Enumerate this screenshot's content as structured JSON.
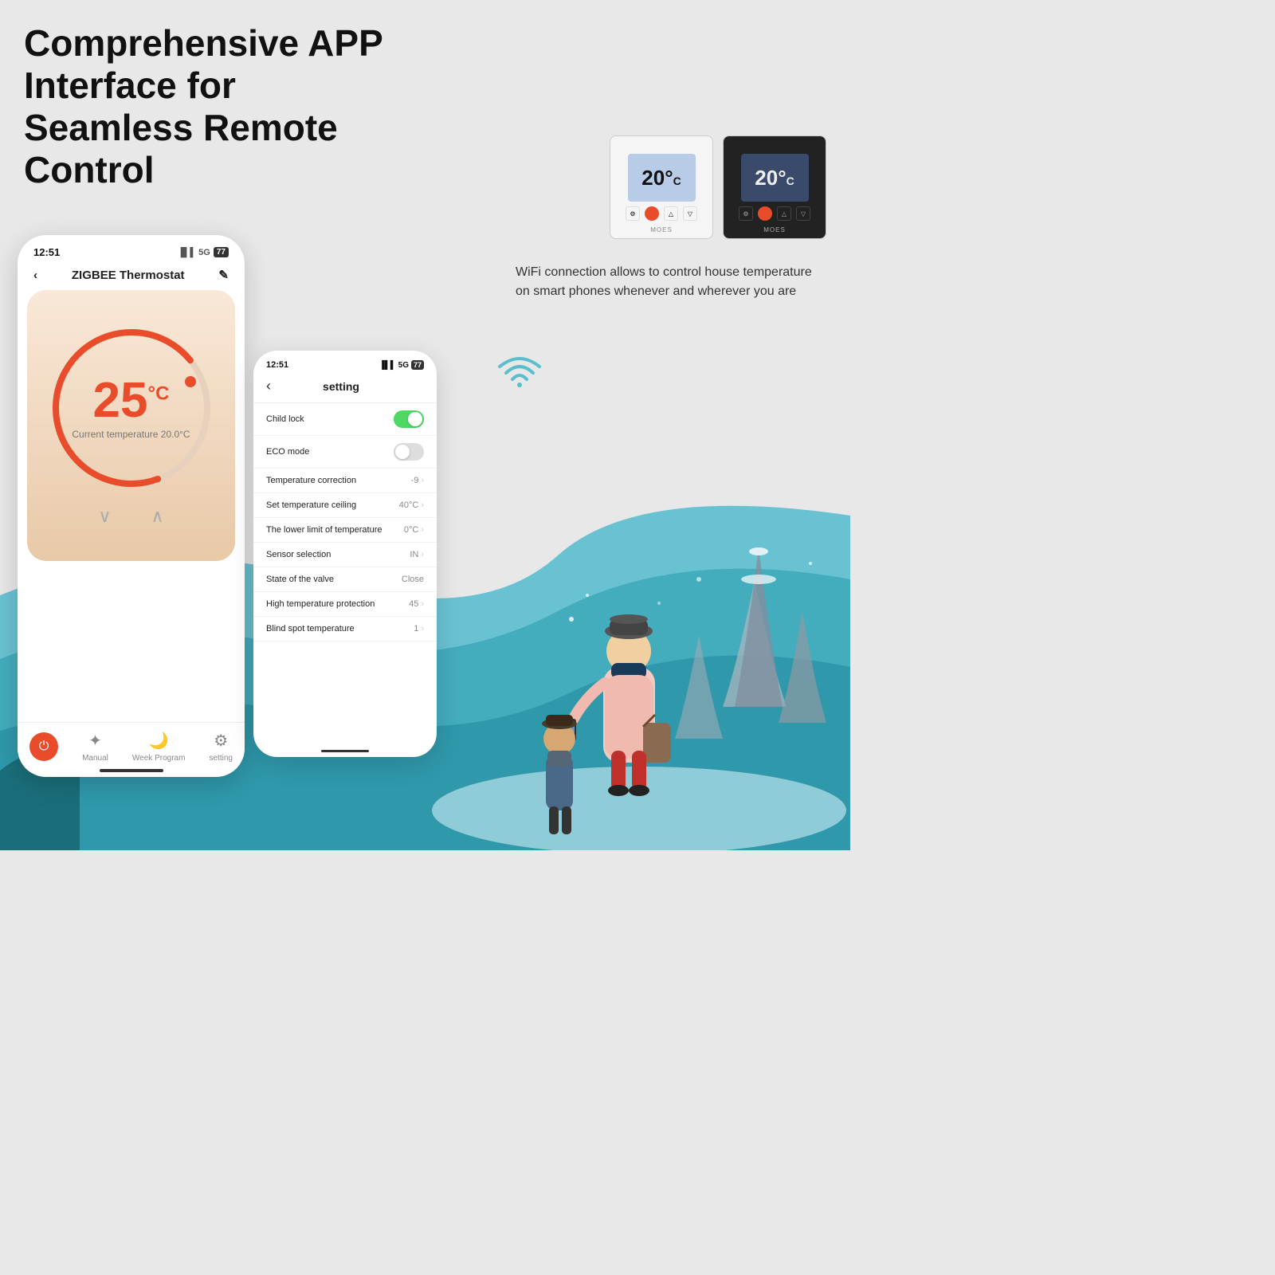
{
  "heading": {
    "line1": "Comprehensive APP Interface for",
    "line2": "Seamless Remote",
    "line3": "Control"
  },
  "wifi_text": "WiFi connection allows to control house temperature on smart phones whenever and wherever you are",
  "device_white": {
    "temp": "20",
    "brand": "MOES"
  },
  "device_black": {
    "temp": "20",
    "brand": "MOES"
  },
  "left_phone": {
    "time": "12:51",
    "title": "ZIGBEE Thermostat",
    "temperature": "25",
    "temp_unit": "°C",
    "current_temp": "Current temperature 20.0°C",
    "nav": {
      "manual": "Manual",
      "week_program": "Week Program",
      "setting": "setting"
    }
  },
  "right_phone": {
    "time": "12:51",
    "header_title": "setting",
    "settings": [
      {
        "label": "Child lock",
        "type": "toggle",
        "value": "on"
      },
      {
        "label": "ECO mode",
        "type": "toggle",
        "value": "off"
      },
      {
        "label": "Temperature correction",
        "type": "nav",
        "value": "-9"
      },
      {
        "label": "Set temperature ceiling",
        "type": "nav",
        "value": "40°C"
      },
      {
        "label": "The lower limit of temperature",
        "type": "nav",
        "value": "0°C"
      },
      {
        "label": "Sensor selection",
        "type": "nav",
        "value": "IN"
      },
      {
        "label": "State of the valve",
        "type": "text",
        "value": "Close"
      },
      {
        "label": "High temperature protection",
        "type": "nav",
        "value": "45"
      },
      {
        "label": "Blind spot temperature",
        "type": "nav",
        "value": "1"
      }
    ]
  },
  "colors": {
    "accent": "#e84c2b",
    "teal": "#4ab5c4",
    "teal_dark": "#2d8fa0"
  }
}
